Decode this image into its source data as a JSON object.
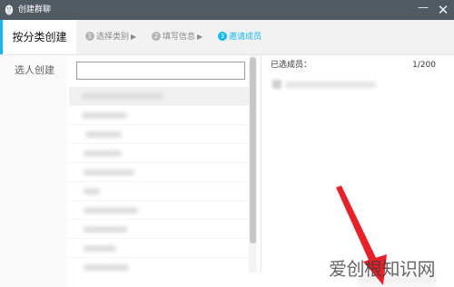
{
  "window": {
    "title": "创建群聊",
    "icon": "qq-penguin-icon",
    "minimize": "—",
    "close": "✕"
  },
  "tabs": {
    "active_label": "按分类创建"
  },
  "steps": [
    {
      "number": "1",
      "label": "选择类别"
    },
    {
      "number": "2",
      "label": "填写信息"
    },
    {
      "number": "3",
      "label": "邀请成员"
    }
  ],
  "left": {
    "label": "选人创建"
  },
  "search": {
    "value": "",
    "placeholder": ""
  },
  "selected": {
    "label": "已选成员：",
    "count": "1/200"
  },
  "watermark": "爱创根知识网",
  "colors": {
    "titlebar": "#505a63",
    "accent": "#12b7f5",
    "annotation_arrow": "#e8202a"
  }
}
